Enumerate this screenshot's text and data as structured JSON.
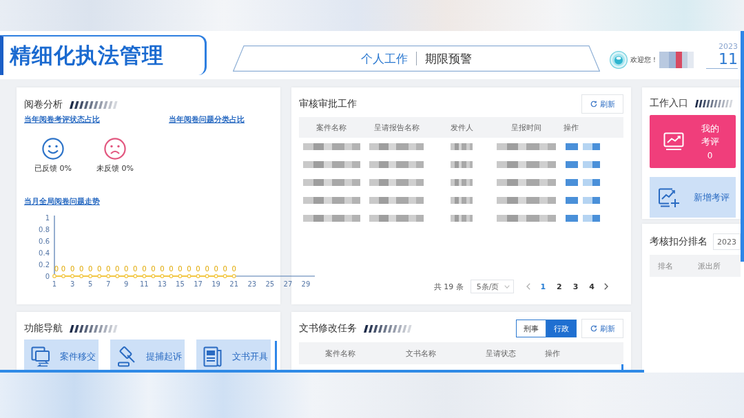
{
  "header": {
    "title": "精细化执法管理",
    "nav": [
      {
        "label": "个人工作",
        "selected": true
      },
      {
        "label": "期限预警",
        "selected": false
      }
    ],
    "welcome": "欢迎您！",
    "user_name_hidden": true,
    "year": "2023",
    "time": "11"
  },
  "review_analysis": {
    "title": "阅卷分析",
    "links": [
      "当年阅卷考评状态占比",
      "当年阅卷问题分类占比"
    ],
    "feedback": [
      {
        "kind": "happy",
        "label": "已反馈 0%"
      },
      {
        "kind": "sad",
        "label": "未反馈 0%"
      }
    ],
    "trend_link": "当月全局阅卷问题走势",
    "chart_data": {
      "type": "line",
      "x": [
        1,
        2,
        3,
        4,
        5,
        6,
        7,
        8,
        9,
        10,
        11,
        12,
        13,
        14,
        15,
        16,
        17,
        18,
        19,
        20,
        21
      ],
      "series": [
        {
          "color": "#f2c744",
          "marker": true,
          "values": [
            0,
            0,
            0,
            0,
            0,
            0,
            0,
            0,
            0,
            0,
            0,
            0,
            0,
            0,
            0,
            0,
            0,
            0,
            0,
            0,
            0
          ]
        }
      ],
      "xlim": [
        1,
        30
      ],
      "ylim": [
        0,
        1
      ],
      "xticks": [
        1,
        3,
        5,
        7,
        9,
        11,
        13,
        15,
        17,
        19,
        21,
        23,
        25,
        27,
        29
      ],
      "yticks": [
        0,
        0.2,
        0.4,
        0.6,
        0.8,
        1
      ],
      "data_labels": true
    }
  },
  "approval_work": {
    "title": "审核审批工作",
    "refresh": "刷新",
    "columns": [
      "案件名称",
      "呈请报告名称",
      "发件人",
      "呈报时间",
      "操作"
    ],
    "rows": [
      {
        "kind": "pixelated"
      },
      {
        "kind": "pixelated"
      },
      {
        "kind": "pixelated"
      },
      {
        "kind": "pixelated"
      },
      {
        "kind": "pixelated"
      }
    ],
    "pagination": {
      "total": "共 19 条",
      "page_size": "5条/页",
      "pages": [
        {
          "label": "1",
          "selected": true
        },
        {
          "label": "2",
          "selected": false
        },
        {
          "label": "3",
          "selected": false
        },
        {
          "label": "4",
          "selected": false
        }
      ]
    }
  },
  "work_entry": {
    "title": "工作入口",
    "tiles": [
      {
        "kind": "count",
        "label": "我的考评",
        "count": "0"
      },
      {
        "kind": "action",
        "label": "新增考评"
      }
    ]
  },
  "ranking": {
    "title": "考核扣分排名",
    "year": "2023",
    "columns": [
      "排名",
      "派出所"
    ]
  },
  "function_nav": {
    "title": "功能导航",
    "items": [
      "案件移交",
      "提捕起诉",
      "文书开具"
    ]
  },
  "document_tasks": {
    "title": "文书修改任务",
    "filters": [
      {
        "label": "刑事",
        "selected": false
      },
      {
        "label": "行政",
        "selected": true
      }
    ],
    "refresh": "刷新",
    "columns": [
      "案件名称",
      "文书名称",
      "呈请状态",
      "操作"
    ]
  }
}
